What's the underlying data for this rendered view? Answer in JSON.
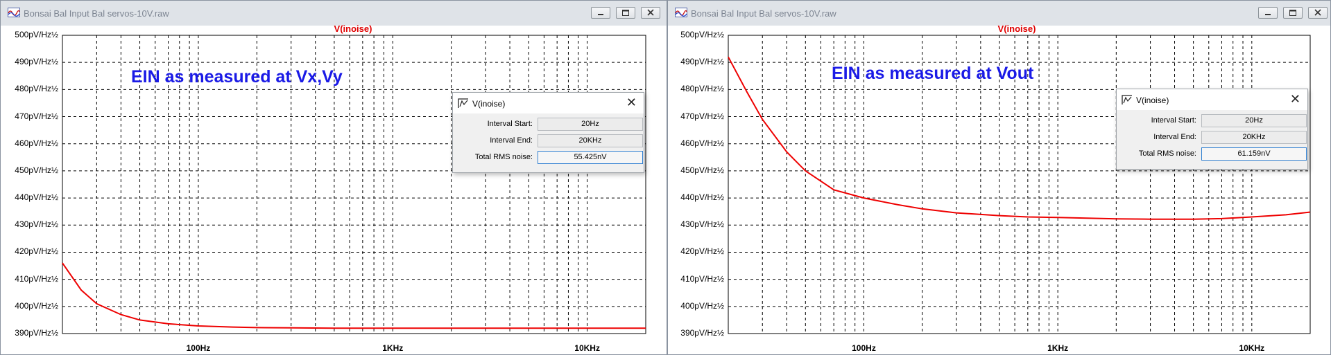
{
  "windows": [
    {
      "title": "Bonsai Bal Input Bal servos-10V.raw",
      "trace_label": "V(inoise)",
      "annotation": "EIN as measured at Vx,Vy",
      "dialog": {
        "title": "V(inoise)",
        "interval_start_label": "Interval Start:",
        "interval_start": "20Hz",
        "interval_end_label": "Interval End:",
        "interval_end": "20KHz",
        "total_label": "Total RMS noise:",
        "total": "55.425nV"
      }
    },
    {
      "title": "Bonsai Bal Input Bal servos-10V.raw",
      "trace_label": "V(inoise)",
      "annotation": "EIN as measured at Vout",
      "dialog": {
        "title": "V(inoise)",
        "interval_start_label": "Interval Start:",
        "interval_start": "20Hz",
        "interval_end_label": "Interval End:",
        "interval_end": "20KHz",
        "total_label": "Total RMS noise:",
        "total": "61.159nV"
      }
    }
  ],
  "chart_data": [
    {
      "type": "line",
      "x_scale": "log",
      "xlim": [
        20,
        20000
      ],
      "ylim": [
        390,
        500
      ],
      "y_unit": "pV/Hz½",
      "yticks": [
        "500pV/Hz½",
        "490pV/Hz½",
        "480pV/Hz½",
        "470pV/Hz½",
        "460pV/Hz½",
        "450pV/Hz½",
        "440pV/Hz½",
        "430pV/Hz½",
        "420pV/Hz½",
        "410pV/Hz½",
        "400pV/Hz½",
        "390pV/Hz½"
      ],
      "xticks": [
        "100Hz",
        "1KHz",
        "10KHz"
      ],
      "grid": true,
      "color": "#ee0000",
      "series": [
        {
          "x": [
            20,
            25,
            30,
            40,
            50,
            70,
            100,
            150,
            200,
            300,
            500,
            1000,
            2000,
            5000,
            10000,
            20000
          ],
          "y": [
            416,
            406,
            401,
            397,
            395,
            393.6,
            392.8,
            392.4,
            392.2,
            392.1,
            392,
            392,
            392,
            392,
            392,
            392
          ]
        }
      ]
    },
    {
      "type": "line",
      "x_scale": "log",
      "xlim": [
        20,
        20000
      ],
      "ylim": [
        390,
        500
      ],
      "y_unit": "pV/Hz½",
      "yticks": [
        "500pV/Hz½",
        "490pV/Hz½",
        "480pV/Hz½",
        "470pV/Hz½",
        "460pV/Hz½",
        "450pV/Hz½",
        "440pV/Hz½",
        "430pV/Hz½",
        "420pV/Hz½",
        "410pV/Hz½",
        "400pV/Hz½",
        "390pV/Hz½"
      ],
      "xticks": [
        "100Hz",
        "1KHz",
        "10KHz"
      ],
      "grid": true,
      "color": "#ee0000",
      "series": [
        {
          "x": [
            20,
            25,
            30,
            40,
            50,
            70,
            100,
            150,
            200,
            300,
            500,
            700,
            1000,
            2000,
            3000,
            5000,
            7000,
            10000,
            15000,
            20000
          ],
          "y": [
            492,
            479,
            469,
            457,
            450,
            443,
            440,
            437.5,
            436,
            434.5,
            433.5,
            433,
            432.8,
            432.3,
            432.2,
            432.2,
            432.4,
            433,
            433.8,
            434.8
          ]
        }
      ]
    }
  ]
}
